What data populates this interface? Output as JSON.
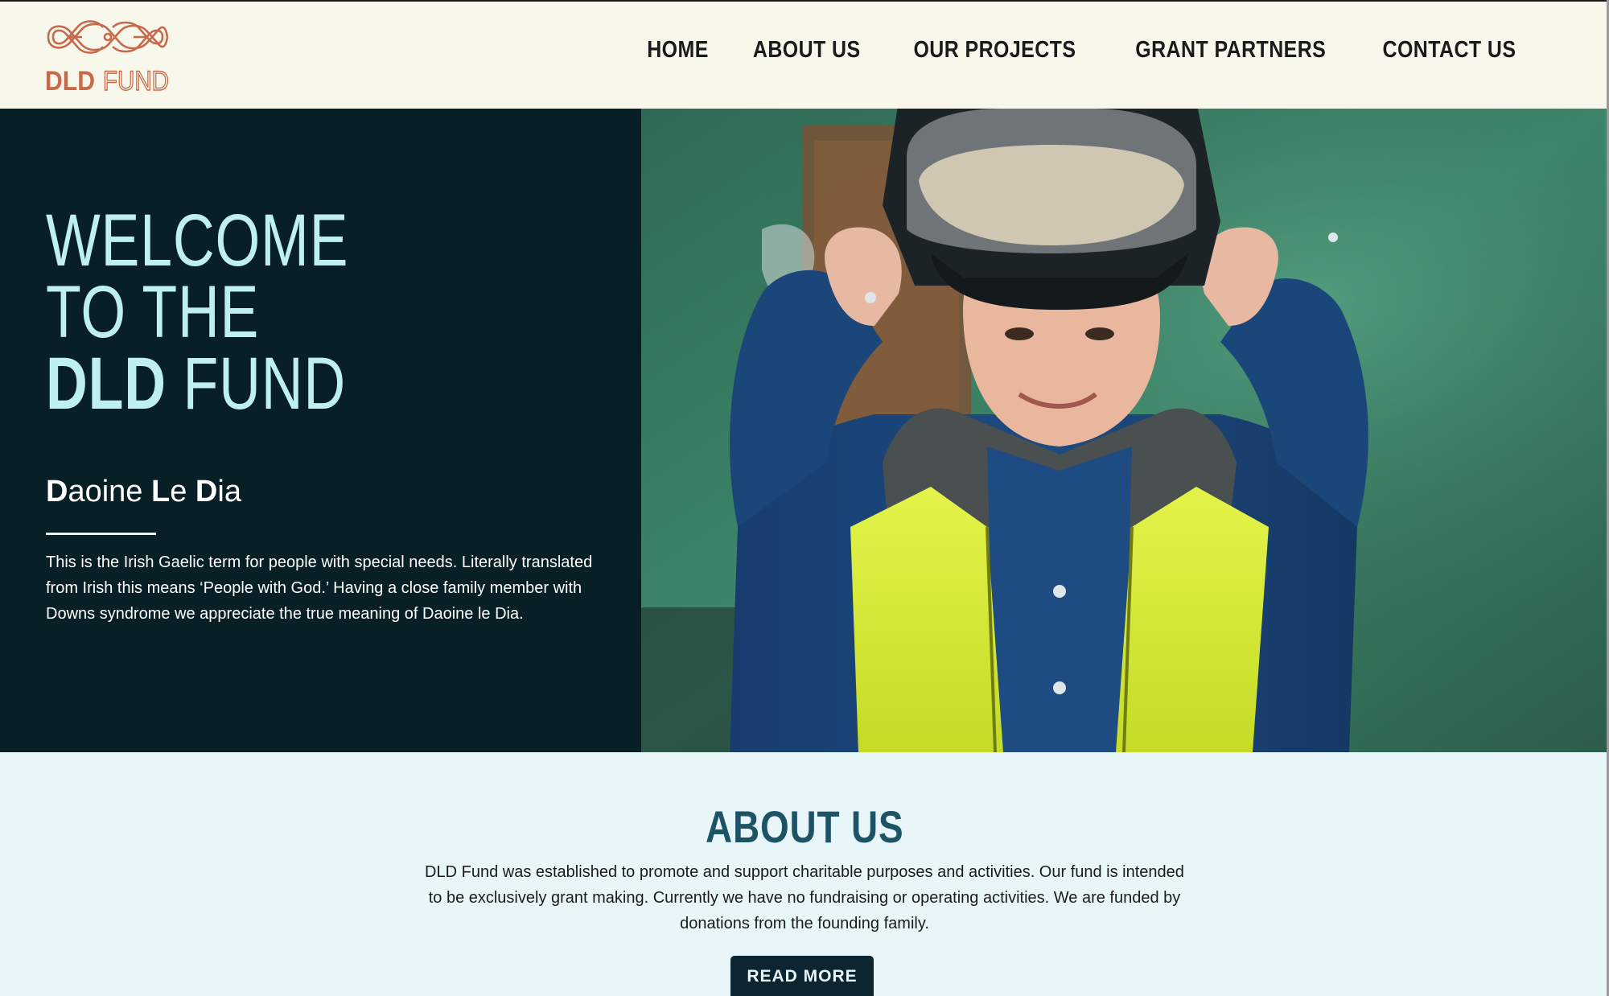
{
  "header": {
    "logo": {
      "word_bold": "DLD",
      "word_outline": "FUND"
    },
    "nav": [
      {
        "label": "HOME"
      },
      {
        "label": "ABOUT US"
      },
      {
        "label": "OUR PROJECTS"
      },
      {
        "label": "GRANT PARTNERS"
      },
      {
        "label": "CONTACT US"
      }
    ]
  },
  "hero": {
    "title_line1": "WELCOME",
    "title_line2": "TO THE",
    "title_line3_bold": "DLD",
    "title_line3_rest": " FUND",
    "subtitle_parts": [
      "D",
      "aoine ",
      "L",
      "e ",
      "D",
      "ia"
    ],
    "body": "This is the Irish Gaelic term for people with special needs. Literally translated from Irish this means ‘People with God.’ Having a close family member with Downs syndrome we appreciate the true meaning of Daoine le Dia."
  },
  "about": {
    "title": "ABOUT US",
    "body": "DLD Fund was established to promote and support charitable purposes and activities. Our fund is intended to be exclusively grant making. Currently we have no fundraising or operating activities. We are funded by donations from the founding family.",
    "button_label": "READ MORE"
  },
  "colors": {
    "header_bg": "#f8f7ec",
    "logo": "#c8694a",
    "hero_bg": "#081f26",
    "hero_title": "#bff0f0",
    "about_bg": "#e8f6f9",
    "about_title": "#1c5365",
    "button_bg": "#0c2530"
  }
}
